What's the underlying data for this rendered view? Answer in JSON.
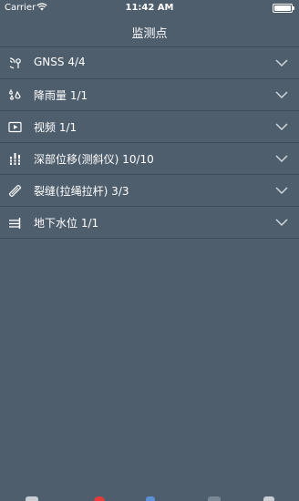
{
  "status_bar": {
    "carrier": "Carrier",
    "time": "11:42 AM"
  },
  "nav": {
    "title": "监测点"
  },
  "items": [
    {
      "label": "GNSS 4/4",
      "icon": "satellite-signal-icon"
    },
    {
      "label": "降雨量 1/1",
      "icon": "rain-drops-icon"
    },
    {
      "label": "视频 1/1",
      "icon": "video-play-icon"
    },
    {
      "label": "深部位移(测斜仪) 10/10",
      "icon": "inclinometer-icon"
    },
    {
      "label": "裂缝(拉绳拉杆) 3/3",
      "icon": "crack-gauge-icon"
    },
    {
      "label": "地下水位 1/1",
      "icon": "water-level-icon"
    }
  ],
  "colors": {
    "background": "#4f5e6d",
    "separator": "#3e4a56",
    "text": "#ffffff"
  }
}
